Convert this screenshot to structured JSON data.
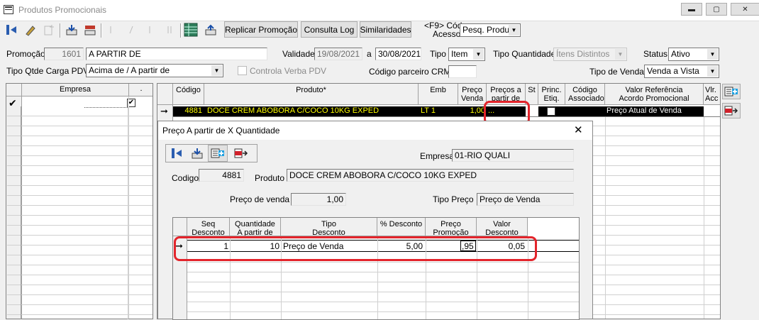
{
  "window": {
    "title": "Produtos Promocionais"
  },
  "toolbar": {
    "replicar_label": "Replicar Promoção",
    "consulta_log_label": "Consulta Log",
    "similaridades_label": "Similaridades",
    "acesso_label_line1": "<F9> Cód",
    "acesso_label_line2": "Acesso",
    "acesso_value": "Pesq. Produto"
  },
  "form": {
    "promocao_label": "Promoção",
    "promocao_code": "1601",
    "promocao_name": "A PARTIR DE",
    "validade_label": "Validade",
    "validade_from": "19/08/2021",
    "validade_sep": "a",
    "validade_to": "30/08/2021",
    "tipo_label": "Tipo",
    "tipo_value": "Item",
    "tipo_quantidade_label": "Tipo Quantidade",
    "tipo_quantidade_value": "Ítens Distintos",
    "status_label": "Status",
    "status_value": "Ativo",
    "tipo_qtde_carga_label": "Tipo Qtde Carga PDV",
    "tipo_qtde_carga_value": "Acima de / A partir de",
    "controla_verba_label": "Controla Verba PDV",
    "codigo_parceiro_label": "Código parceiro CRM",
    "codigo_parceiro_value": "",
    "tipo_venda_label": "Tipo de Venda",
    "tipo_venda_value": "Venda a Vista"
  },
  "empresa_grid": {
    "header": "Empresa",
    "header2": "."
  },
  "produtos_grid": {
    "headers": [
      "Código",
      "Produto*",
      "Emb",
      "Preço Venda",
      "Preços a partir de",
      "St",
      "Princ. Etiq.",
      "Código Associado",
      "Valor Referência Acordo Promocional",
      "Vlr. Acc"
    ],
    "row": {
      "codigo": "4881",
      "produto": "DOCE CREM ABOBORA C/COCO 10KG EXPED",
      "emb": "LT  1",
      "preco_venda": "1,00",
      "precos_partir": "...",
      "valor_referencia": "Preço Atual de Venda"
    }
  },
  "dialog": {
    "title": "Preço A partir de X Quantidade",
    "empresa_label": "Empresa",
    "empresa_value": "01-RIO QUALI",
    "codigo_label": "Codigo",
    "codigo_value": "4881",
    "produto_label": "Produto",
    "produto_value": "DOCE CREM ABOBORA C/COCO 10KG EXPED",
    "preco_venda_label": "Preço de venda",
    "preco_venda_value": "1,00",
    "tipo_preco_label": "Tipo Preço",
    "tipo_preco_value": "Preço de Venda",
    "grid_headers": [
      {
        "l1": "Seq",
        "l2": "Desconto"
      },
      {
        "l1": "Quantidade",
        "l2": "A partir de"
      },
      {
        "l1": "Tipo",
        "l2": "Desconto"
      },
      {
        "l1": "% Desconto",
        "l2": ""
      },
      {
        "l1": "Preço",
        "l2": "Promoção"
      },
      {
        "l1": "Valor",
        "l2": "Desconto"
      }
    ],
    "row": {
      "seq": "1",
      "quantidade": "10",
      "tipo": "Preço de Venda",
      "pct": "5,00",
      "preco": ",95",
      "valor": "0,05"
    }
  },
  "colors": {
    "highlight": "#e3242b",
    "selected_row_bg": "#000000",
    "selected_row_text": "#ffff00"
  }
}
